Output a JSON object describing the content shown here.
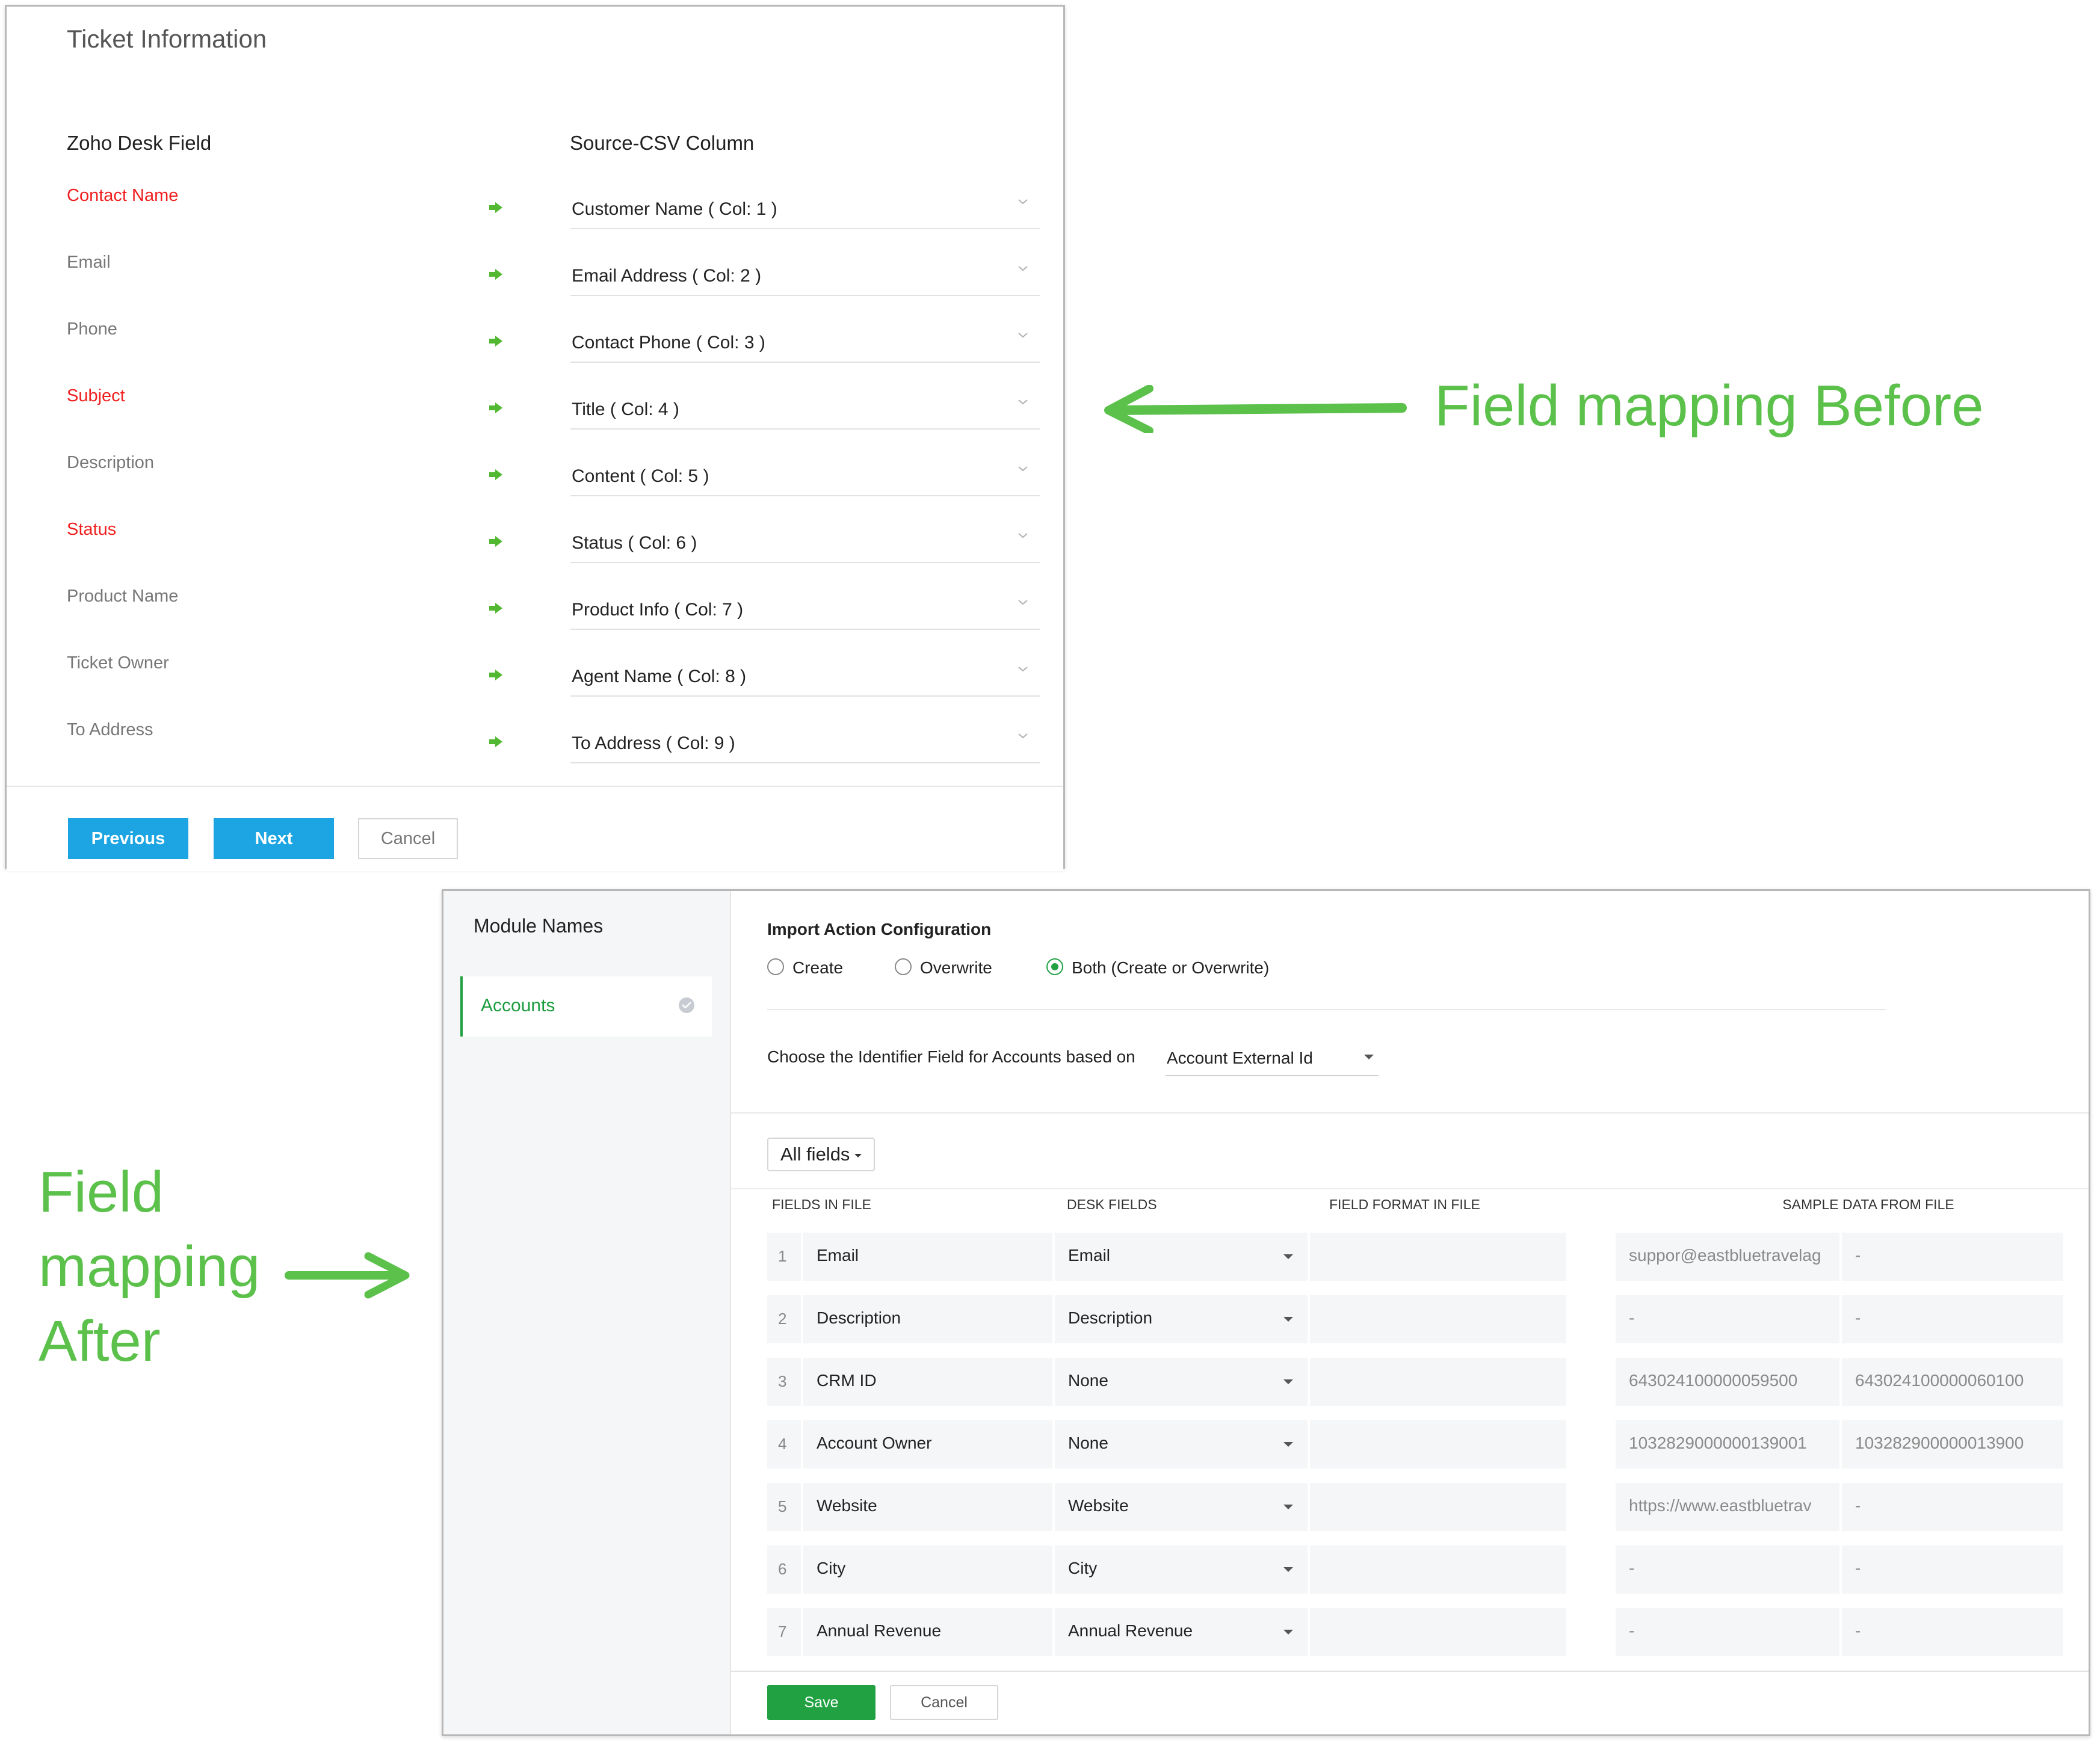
{
  "before_panel": {
    "title": "Ticket Information",
    "zoho_header": "Zoho Desk Field",
    "csv_header": "Source-CSV Column",
    "rows": [
      {
        "field": "Contact Name",
        "required": true,
        "column": "Customer Name ( Col: 1 )"
      },
      {
        "field": "Email",
        "required": false,
        "column": "Email Address ( Col: 2 )"
      },
      {
        "field": "Phone",
        "required": false,
        "column": "Contact Phone ( Col: 3 )"
      },
      {
        "field": "Subject",
        "required": true,
        "column": "Title ( Col: 4 )"
      },
      {
        "field": "Description",
        "required": false,
        "column": "Content ( Col: 5 )"
      },
      {
        "field": "Status",
        "required": true,
        "column": "Status ( Col: 6 )"
      },
      {
        "field": "Product Name",
        "required": false,
        "column": "Product Info ( Col: 7 )"
      },
      {
        "field": "Ticket Owner",
        "required": false,
        "column": "Agent Name ( Col: 8 )"
      },
      {
        "field": "To Address",
        "required": false,
        "column": "To Address ( Col: 9 )"
      }
    ],
    "buttons": {
      "previous": "Previous",
      "next": "Next",
      "cancel": "Cancel"
    }
  },
  "annotations": {
    "before_label": "Field mapping Before",
    "after_label_lines": [
      "Field",
      "mapping",
      "After"
    ]
  },
  "after_panel": {
    "sidebar": {
      "title": "Module Names",
      "selected_module": "Accounts"
    },
    "import_config": {
      "title": "Import Action Configuration",
      "options": [
        "Create",
        "Overwrite",
        "Both (Create or Overwrite)"
      ],
      "selected": "Both (Create or Overwrite)"
    },
    "identifier": {
      "label": "Choose the Identifier Field for Accounts based on",
      "value": "Account External Id"
    },
    "filter_label": "All fields",
    "table": {
      "headers": [
        "FIELDS IN FILE",
        "DESK FIELDS",
        "FIELD FORMAT IN FILE",
        "SAMPLE DATA FROM FILE"
      ],
      "rows": [
        {
          "num": "1",
          "file_field": "Email",
          "desk_field": "Email",
          "sample1": "suppor@eastbluetravelag",
          "sample2": "-"
        },
        {
          "num": "2",
          "file_field": "Description",
          "desk_field": "Description",
          "sample1": "-",
          "sample2": "-"
        },
        {
          "num": "3",
          "file_field": "CRM ID",
          "desk_field": "None",
          "sample1": "643024100000059500",
          "sample2": "643024100000060100"
        },
        {
          "num": "4",
          "file_field": "Account Owner",
          "desk_field": "None",
          "sample1": "1032829000000139001",
          "sample2": "103282900000013900"
        },
        {
          "num": "5",
          "file_field": "Website",
          "desk_field": "Website",
          "sample1": "https://www.eastbluetrav",
          "sample2": "-"
        },
        {
          "num": "6",
          "file_field": "City",
          "desk_field": "City",
          "sample1": "-",
          "sample2": "-"
        },
        {
          "num": "7",
          "file_field": "Annual Revenue",
          "desk_field": "Annual Revenue",
          "sample1": "-",
          "sample2": "-"
        }
      ]
    },
    "buttons": {
      "save": "Save",
      "cancel": "Cancel"
    }
  },
  "colors": {
    "required_red": "#f01f1f",
    "primary_blue": "#1ca5e2",
    "accent_green": "#22a143",
    "annotation_green": "#5bc14b",
    "map_arrow_green": "#52b832"
  }
}
